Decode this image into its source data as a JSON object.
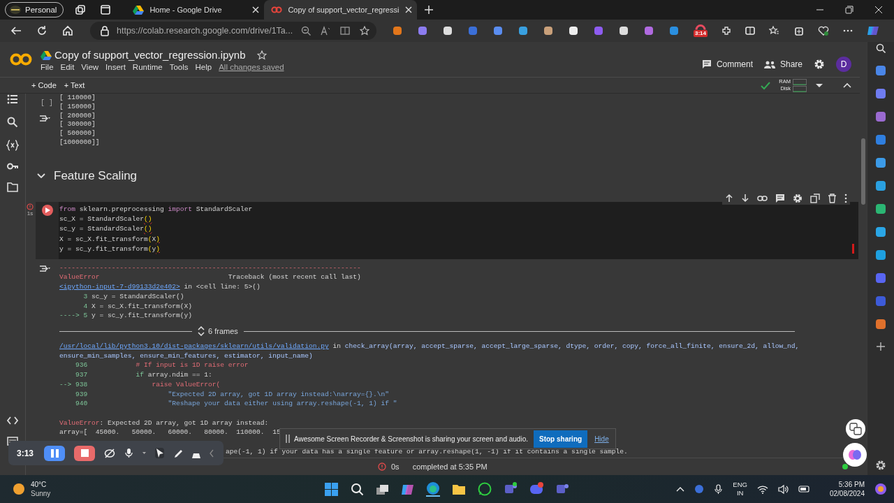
{
  "browser": {
    "profile": "Personal",
    "tabs": [
      {
        "title": "Home - Google Drive",
        "selected": false
      },
      {
        "title": "Copy of support_vector_regressi",
        "selected": true
      }
    ],
    "url": "https://colab.research.google.com/drive/1Ta...",
    "extension_badge": "3:14"
  },
  "notebook": {
    "title": "Copy of support_vector_regression.ipynb",
    "menu": [
      "File",
      "Edit",
      "View",
      "Insert",
      "Runtime",
      "Tools",
      "Help"
    ],
    "save_status": "All changes saved",
    "comment": "Comment",
    "share": "Share",
    "avatar": "D"
  },
  "toolbar": {
    "add_code": "+ Code",
    "add_text": "+ Text",
    "ram": "RAM",
    "disk": "Disk"
  },
  "output_prompt": "[ ]",
  "output_lines": [
    "[ 110000]",
    "[ 150000]",
    "[ 200000]",
    "[ 300000]",
    "[ 500000]",
    "[1000000]]"
  ],
  "section": {
    "title": "Feature Scaling",
    "expanded": true
  },
  "code_cell": {
    "duration": "1s",
    "lines": [
      [
        {
          "text": "from",
          "kind": "k"
        },
        {
          "text": " sklearn.preprocessing ",
          "kind": "d"
        },
        {
          "text": "import",
          "kind": "k"
        },
        {
          "text": " StandardScaler",
          "kind": "d"
        }
      ],
      [
        {
          "text": "sc_X = StandardScaler",
          "kind": "d"
        },
        {
          "text": "()",
          "kind": "y"
        }
      ],
      [
        {
          "text": "sc_y = StandardScaler",
          "kind": "d"
        },
        {
          "text": "()",
          "kind": "y"
        }
      ],
      [
        {
          "text": "X = sc_X.fit_transform",
          "kind": "d"
        },
        {
          "text": "(",
          "kind": "y"
        },
        {
          "text": "X",
          "kind": "d"
        },
        {
          "text": ")",
          "kind": "y"
        }
      ],
      [
        {
          "text": "y = sc_y.fit_transform",
          "kind": "d"
        },
        {
          "text": "(",
          "kind": "y"
        },
        {
          "text": "y",
          "kind": "d"
        },
        {
          "text": ")",
          "kind": "y"
        }
      ]
    ]
  },
  "traceback": [
    [
      {
        "text": "---------------------------------------------------------------------------",
        "kind": "r"
      }
    ],
    [
      {
        "text": "ValueError",
        "kind": "r"
      },
      {
        "text": "                                Traceback (most recent call last)",
        "kind": "d"
      }
    ],
    [
      {
        "text": "<ipython-input-7-d99133d2e402>",
        "kind": "a"
      },
      {
        "text": " in <cell line: 5>()",
        "kind": "d"
      }
    ],
    [
      {
        "text": "      3 ",
        "kind": "g"
      },
      {
        "text": "sc_y = StandardScaler()",
        "kind": "d"
      }
    ],
    [
      {
        "text": "      4 ",
        "kind": "g"
      },
      {
        "text": "X = sc_X.fit_transform(X)",
        "kind": "d"
      }
    ],
    [
      {
        "text": "----> 5 ",
        "kind": "g"
      },
      {
        "text": "y = sc_y.fit_transform(y)",
        "kind": "d"
      }
    ]
  ],
  "frames_label": "6 frames",
  "frames": [
    [
      {
        "text": "/usr/local/lib/python3.10/dist-packages/sklearn/utils/validation.py",
        "kind": "a"
      },
      {
        "text": " in ",
        "kind": "d"
      },
      {
        "text": "check_array(array, accept_sparse, accept_large_sparse, dtype, order, copy, force_all_finite, ensure_2d, allow_nd,",
        "kind": "b"
      }
    ],
    [
      {
        "text": "ensure_min_samples, ensure_min_features, estimator, input_name)",
        "kind": "b"
      }
    ],
    [
      {
        "text": "    936 ",
        "kind": "g"
      },
      {
        "text": "           # If input is 1D raise error",
        "kind": "c"
      }
    ],
    [
      {
        "text": "    937 ",
        "kind": "g"
      },
      {
        "text": "           if",
        "kind": "g"
      },
      {
        "text": " array.ndim == 1:",
        "kind": "d"
      }
    ],
    [
      {
        "text": "--> 938 ",
        "kind": "g"
      },
      {
        "text": "               raise ValueError(",
        "kind": "c"
      }
    ],
    [
      {
        "text": "    939 ",
        "kind": "g"
      },
      {
        "text": "                   \"Expected 2D array, got 1D array instead:\\narray={}.\\n\"",
        "kind": "s"
      }
    ],
    [
      {
        "text": "    940 ",
        "kind": "g"
      },
      {
        "text": "                   \"Reshape your data either using array.reshape(-1, 1) if \"",
        "kind": "s"
      }
    ]
  ],
  "error_lines": [
    [
      {
        "text": "ValueError",
        "kind": "r"
      },
      {
        "text": ": Expected 2D array, got 1D array instead:",
        "kind": "d"
      }
    ],
    [
      {
        "text": "array=[  45000.   50000.   60000.   80000.  110000.  15",
        "kind": "d"
      }
    ]
  ],
  "error_tail": "ape(-1, 1) if your data has a single feature or array.reshape(1, -1) if it contains a single sample.",
  "status": {
    "time": "0s",
    "completed": "completed at 5:35 PM"
  },
  "recorder": {
    "time": "3:13"
  },
  "share_bar": {
    "message": "Awesome Screen Recorder & Screenshot is sharing your screen and audio.",
    "stop": "Stop sharing",
    "hide": "Hide"
  },
  "taskbar": {
    "temperature": "40°C",
    "weather": "Sunny",
    "language": "ENG",
    "region": "IN",
    "time": "5:36 PM",
    "date": "02/08/2024"
  }
}
